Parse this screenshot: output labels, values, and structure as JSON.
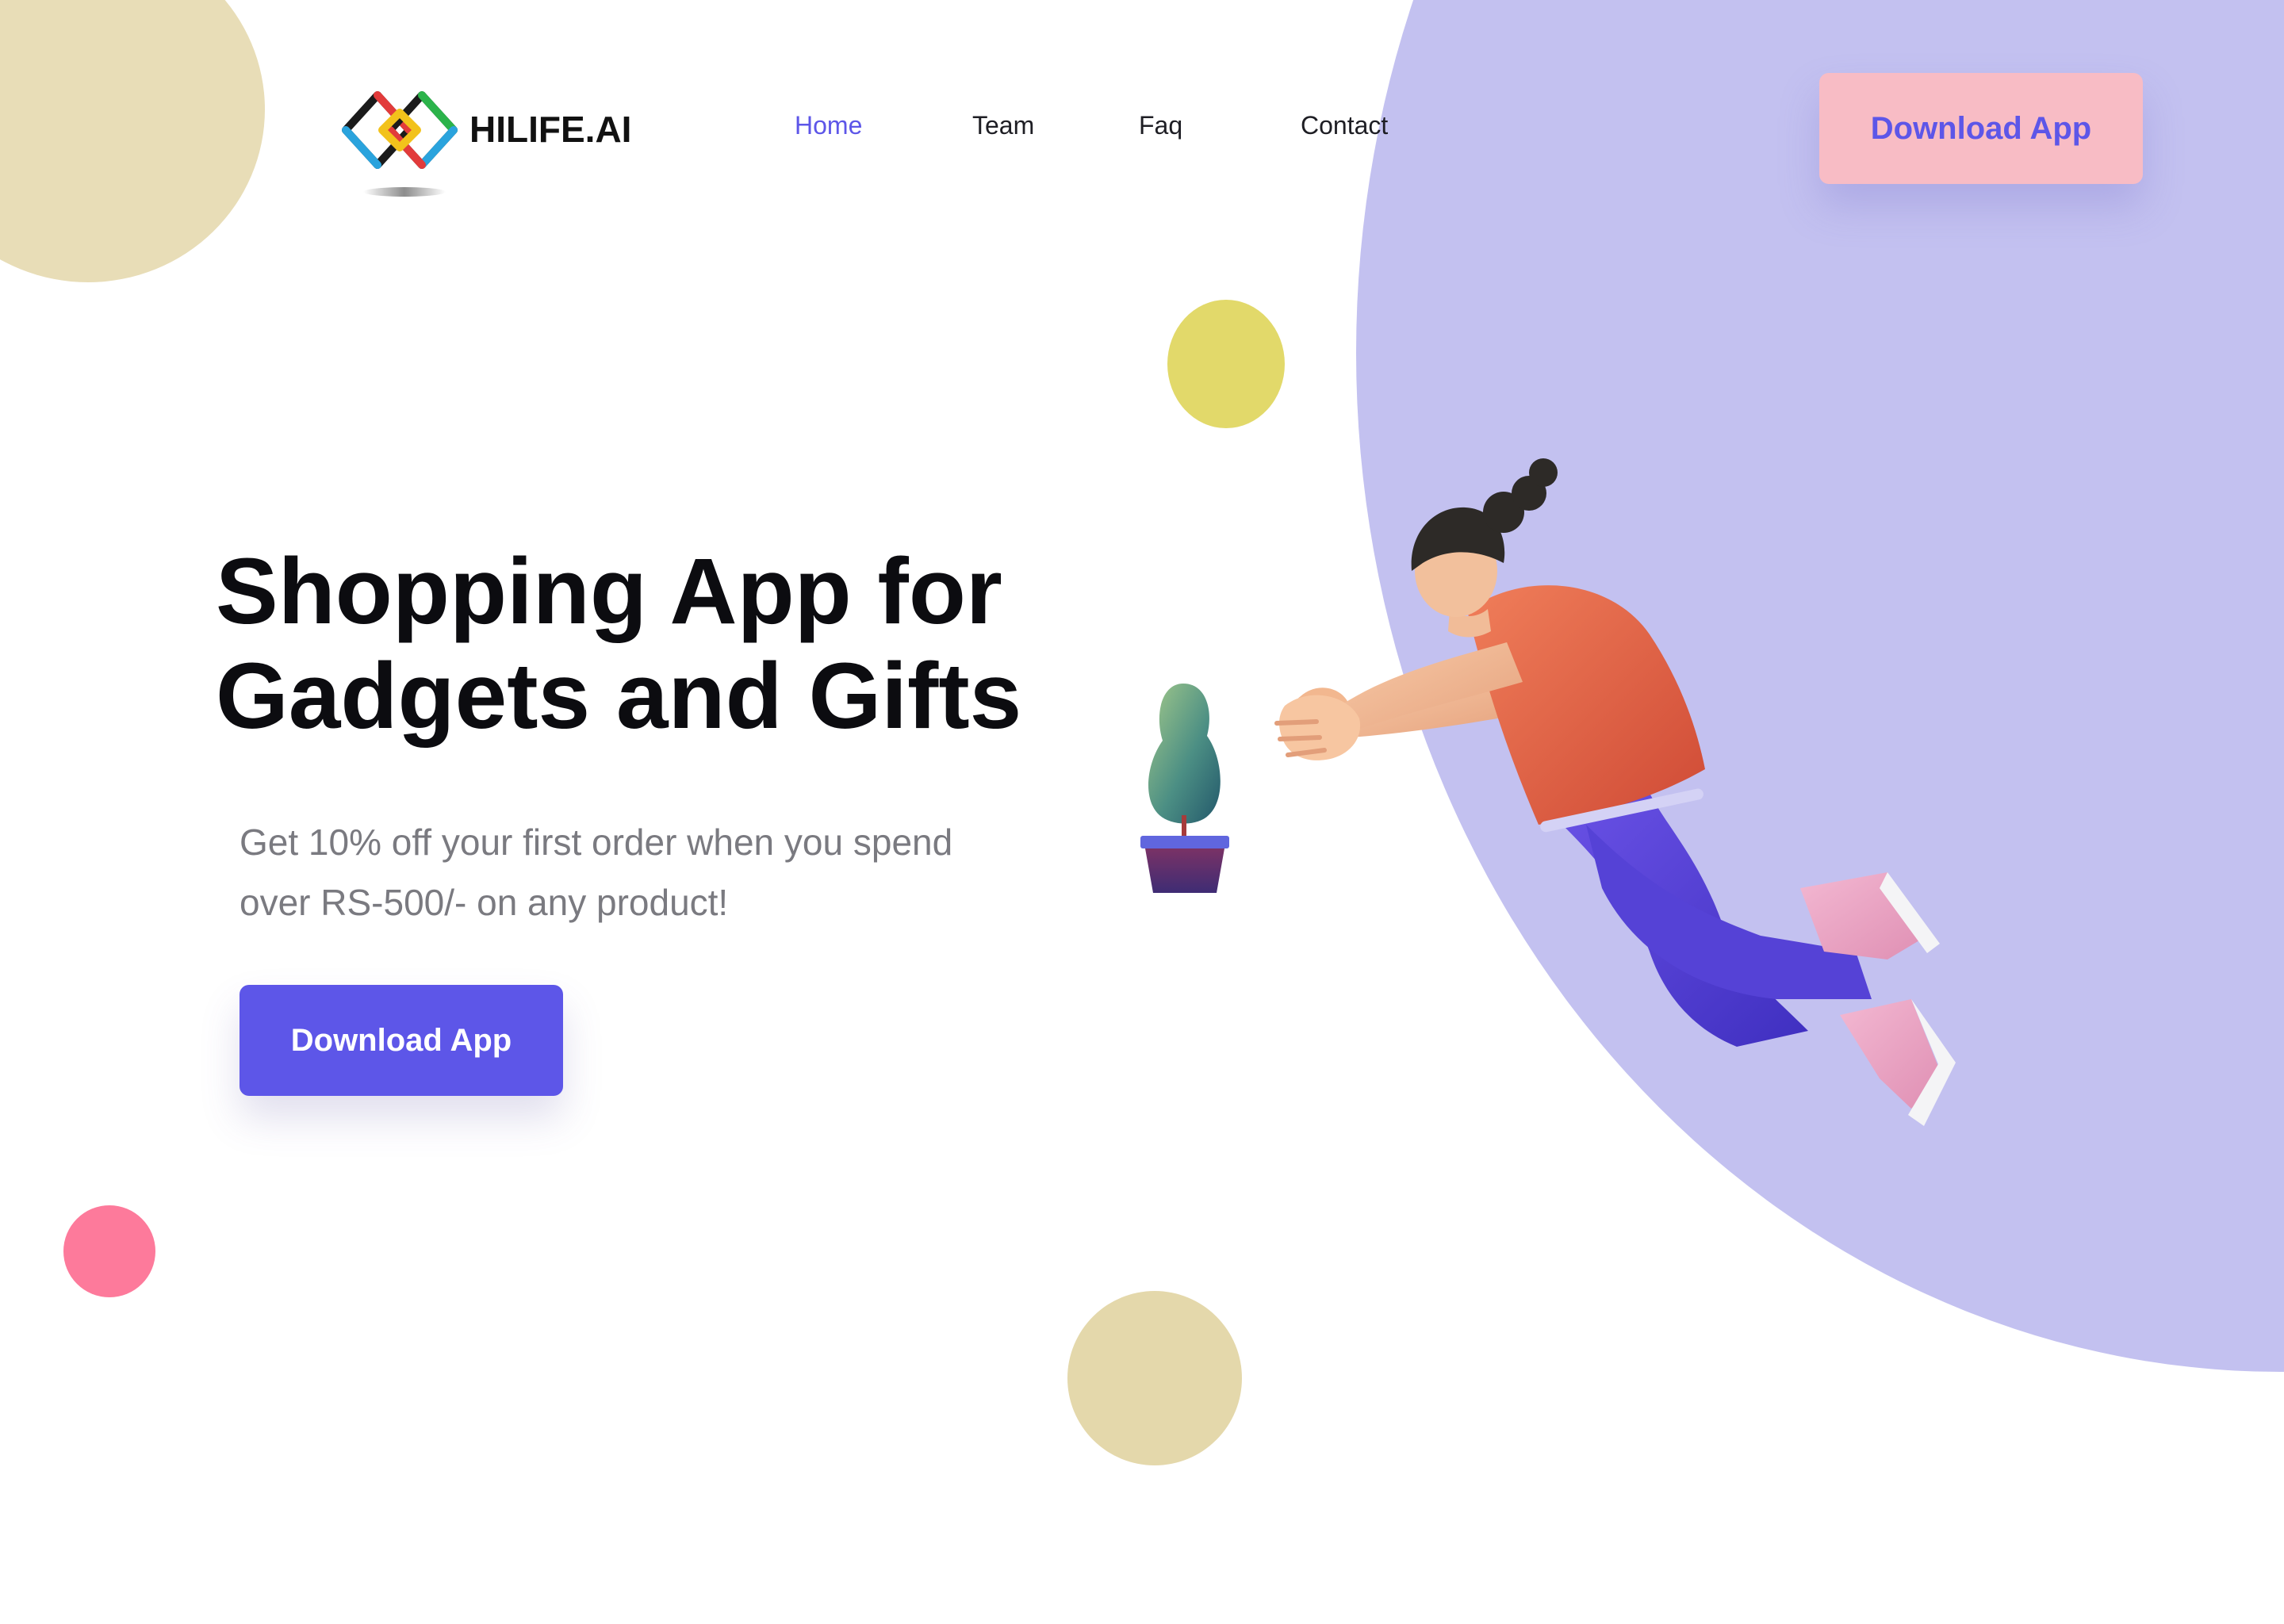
{
  "brand": {
    "name": "HILIFE.AI",
    "logo_icon": "interlocking-rings-logo-icon"
  },
  "nav": {
    "items": [
      {
        "label": "Home",
        "active": true
      },
      {
        "label": "Team",
        "active": false
      },
      {
        "label": "Faq",
        "active": false
      },
      {
        "label": "Contact",
        "active": false
      }
    ]
  },
  "header_cta": {
    "label": "Download App"
  },
  "hero": {
    "title_line1": "Shopping App for",
    "title_line2": "Gadgets and Gifts",
    "subtitle_line1": "Get 10% off your first order when you spend",
    "subtitle_line2": "over RS-500/- on any product!",
    "cta_label": "Download App"
  },
  "illustrations": {
    "plant": "potted-plant-illustration",
    "figure": "flying-person-illustration"
  },
  "colors": {
    "accent": "#5d56e8",
    "header_button_bg": "#f8bcc5",
    "big_circle": "#c3c1f0",
    "tan_circle": "#e8ddb7",
    "yellow_circle": "#e2d96a",
    "pink_circle": "#fd7a9b",
    "title_text": "#0c0c10",
    "subtitle_text": "#7a7a80"
  }
}
